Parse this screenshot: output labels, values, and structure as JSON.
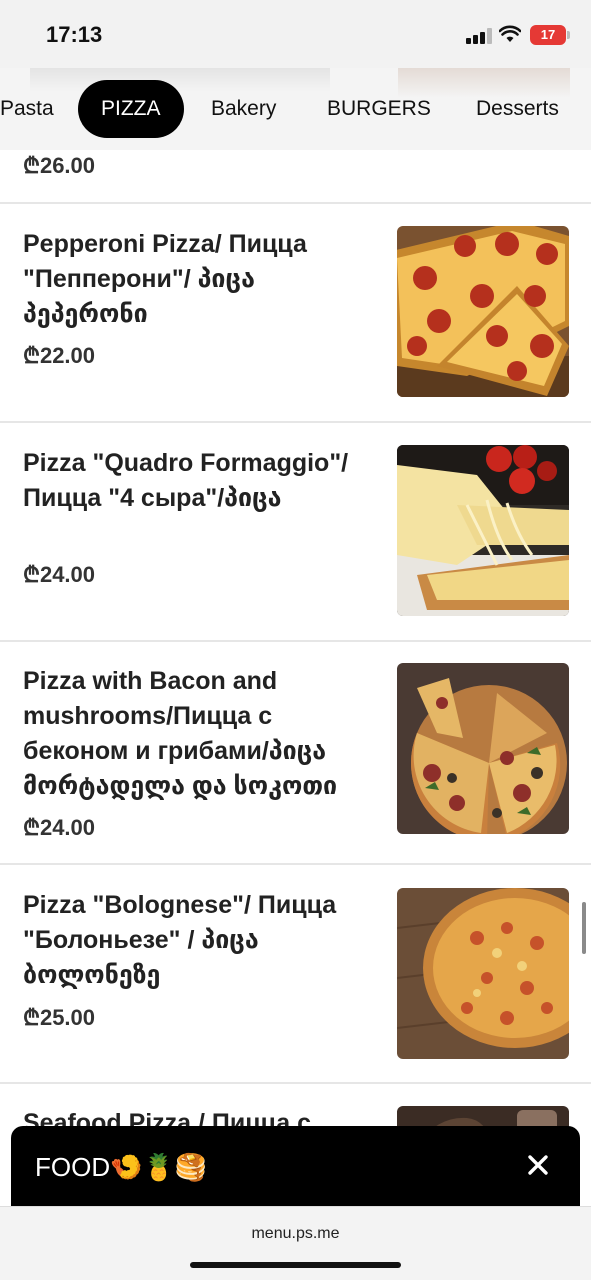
{
  "status": {
    "time": "17:13",
    "battery": "17"
  },
  "tabs": [
    {
      "label": "Pasta"
    },
    {
      "label": "PIZZA",
      "active": true
    },
    {
      "label": "Bakery"
    },
    {
      "label": "BURGERS"
    },
    {
      "label": "Desserts"
    }
  ],
  "prev_price": "₾26.00",
  "items": [
    {
      "title": "Pepperoni Pizza/ Пицца \"Пепперони\"/ პიცა პეპერონი",
      "price": "₾22.00"
    },
    {
      "title": "Pizza \"Quadro Formaggio\"/Пицца \"4 сыра\"/პიცა",
      "price": "₾24.00"
    },
    {
      "title": "Pizza with Bacon and mushrooms/Пицца с беконом и грибами/პიცა მორტადელა და სოკოთი",
      "price": "₾24.00"
    },
    {
      "title": "Pizza \"Bolognese\"/ Пицца \"Болоньезе\" / პიცა ბოლონეზე",
      "price": "₾25.00"
    },
    {
      "title": "Seafood Pizza / Пицца с",
      "price": ""
    }
  ],
  "banner": {
    "text": "FOOD🍤🍍🥞"
  },
  "browser": {
    "url": "menu.ps.me"
  }
}
